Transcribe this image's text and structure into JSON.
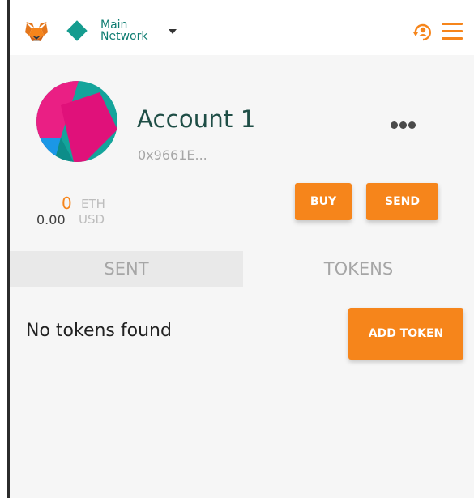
{
  "header": {
    "network_line1": "Main",
    "network_line2": "Network"
  },
  "account": {
    "name": "Account 1",
    "address": "0x9661E...",
    "eth_amount": "0",
    "eth_unit": "ETH",
    "usd_amount": "0.00",
    "usd_unit": "USD"
  },
  "actions": {
    "buy_label": "BUY",
    "send_label": "SEND"
  },
  "tabs": [
    {
      "label": "SENT"
    },
    {
      "label": "TOKENS"
    }
  ],
  "tokens": {
    "empty_message": "No tokens found",
    "add_token_label": "ADD TOKEN"
  },
  "colors": {
    "accent": "#f6851b",
    "network": "#159c8f",
    "account_name": "#1f4e46"
  },
  "icons": {
    "logo": "metamask-fox-icon",
    "network": "network-diamond-icon",
    "account": "account-switch-icon",
    "menu": "hamburger-menu-icon",
    "more": "more-dots-icon"
  }
}
